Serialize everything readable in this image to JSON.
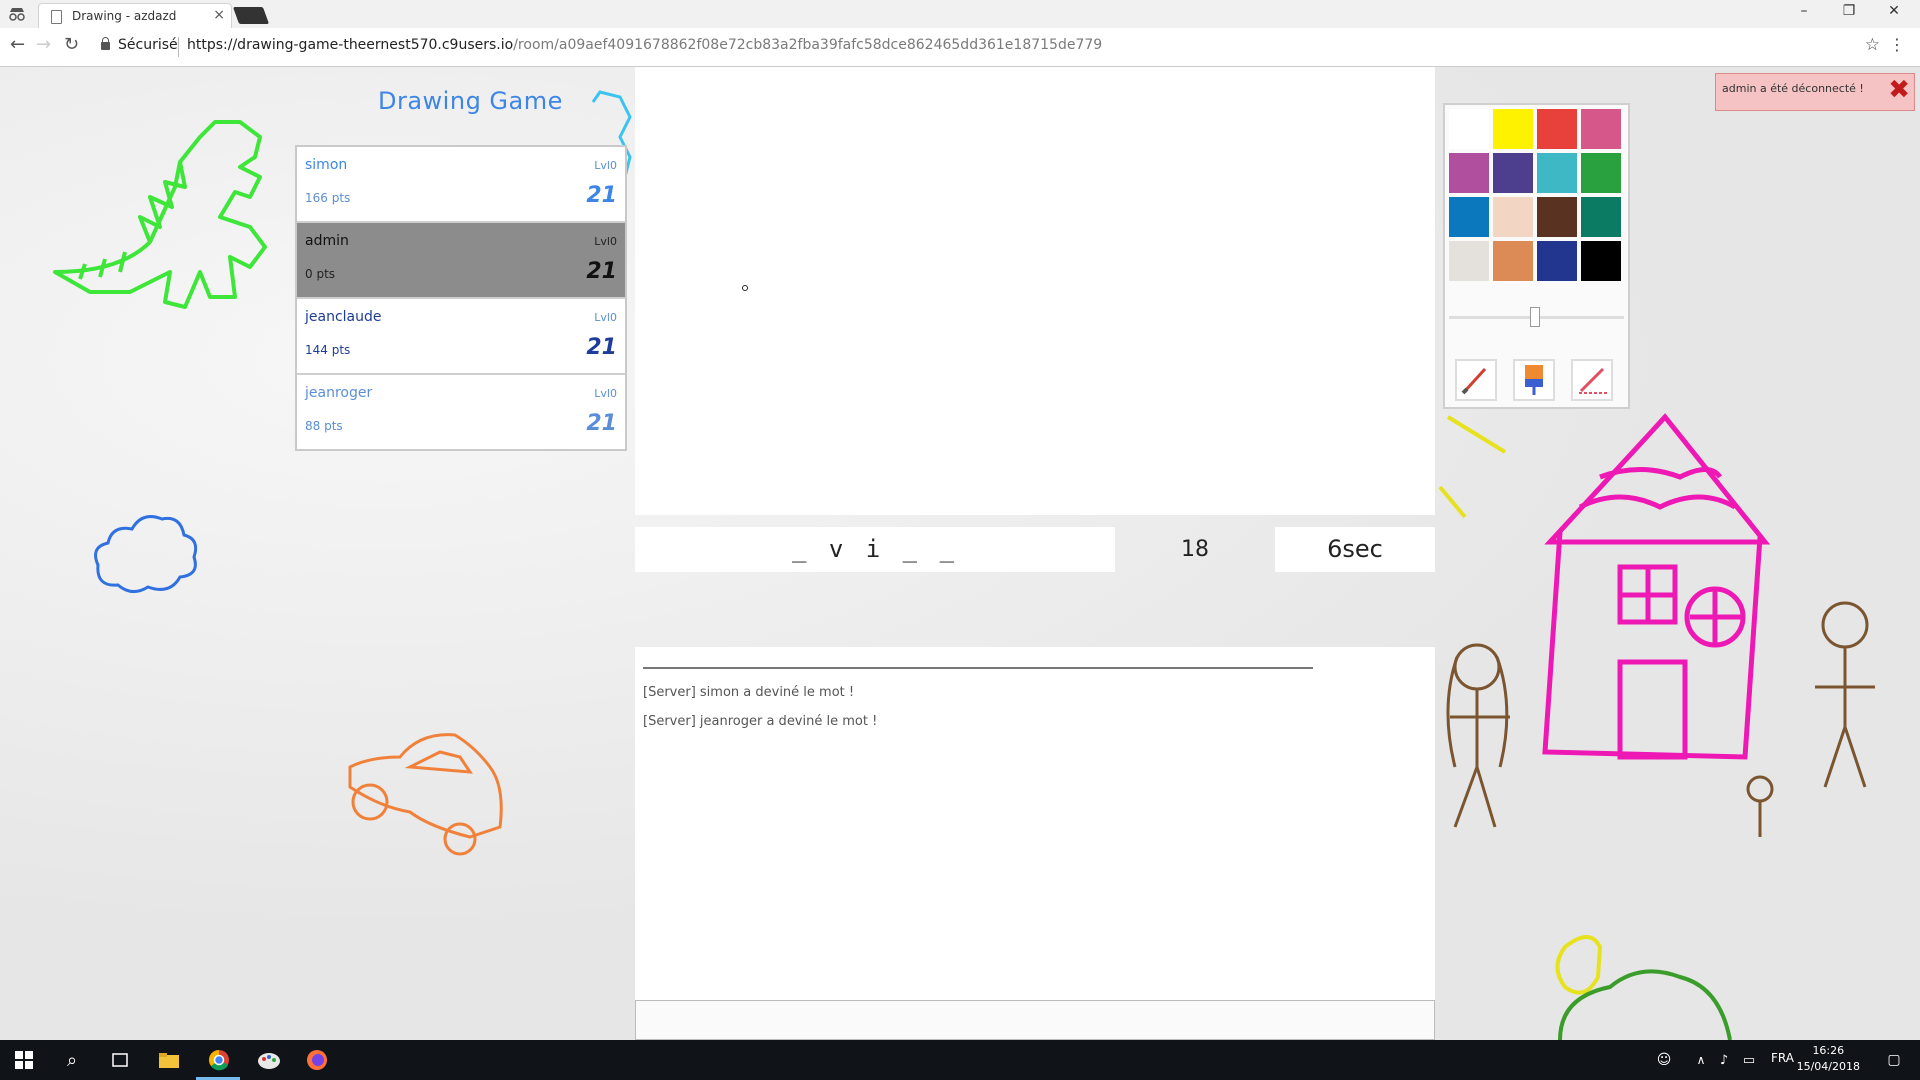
{
  "browser": {
    "tab_title": "Drawing - azdazd",
    "tab_close": "×",
    "secure_label": "Sécurisé",
    "url_host": "https://drawing-game-theernest570.c9users.io",
    "url_path": "/room/a09aef4091678862f08e72cb83a2fba39fafc58dce862465dd361e18715de779",
    "minimize": "–",
    "maximize": "❐",
    "close": "✕"
  },
  "game": {
    "title": "Drawing Game",
    "players": [
      {
        "name": "simon",
        "points": "166 pts",
        "level": "Lvl0",
        "number": "21",
        "color": "#3d86e8",
        "active": false
      },
      {
        "name": "admin",
        "points": "0 pts",
        "level": "Lvl0",
        "number": "21",
        "color": "#111111",
        "active": true
      },
      {
        "name": "jeanclaude",
        "points": "144 pts",
        "level": "Lvl0",
        "number": "21",
        "color": "#1e3c9a",
        "active": false
      },
      {
        "name": "jeanroger",
        "points": "88 pts",
        "level": "Lvl0",
        "number": "21",
        "color": "#5a8ed8",
        "active": false
      }
    ],
    "hint": "_ v i _ _",
    "count": "18",
    "timer": "6sec",
    "chat": [
      "[Server] simon a deviné le mot !",
      "[Server] jeanroger a deviné le mot !"
    ],
    "notification": "admin a été déconnecté !",
    "notification_close": "✖",
    "palette": [
      "#ffffff",
      "#fff200",
      "#e8403a",
      "#d6588a",
      "#b04f9d",
      "#4e3f8e",
      "#3fb8c6",
      "#2aa13f",
      "#0b77bd",
      "#f2d5c3",
      "#5a3222",
      "#0b7c63",
      "#e4e1dd",
      "#dc8a56",
      "#223690",
      "#000000"
    ],
    "tools": [
      "brush-icon",
      "fill-bucket-icon",
      "eraser-icon"
    ]
  },
  "taskbar": {
    "lang": "FRA",
    "time": "16:26",
    "date": "15/04/2018"
  }
}
